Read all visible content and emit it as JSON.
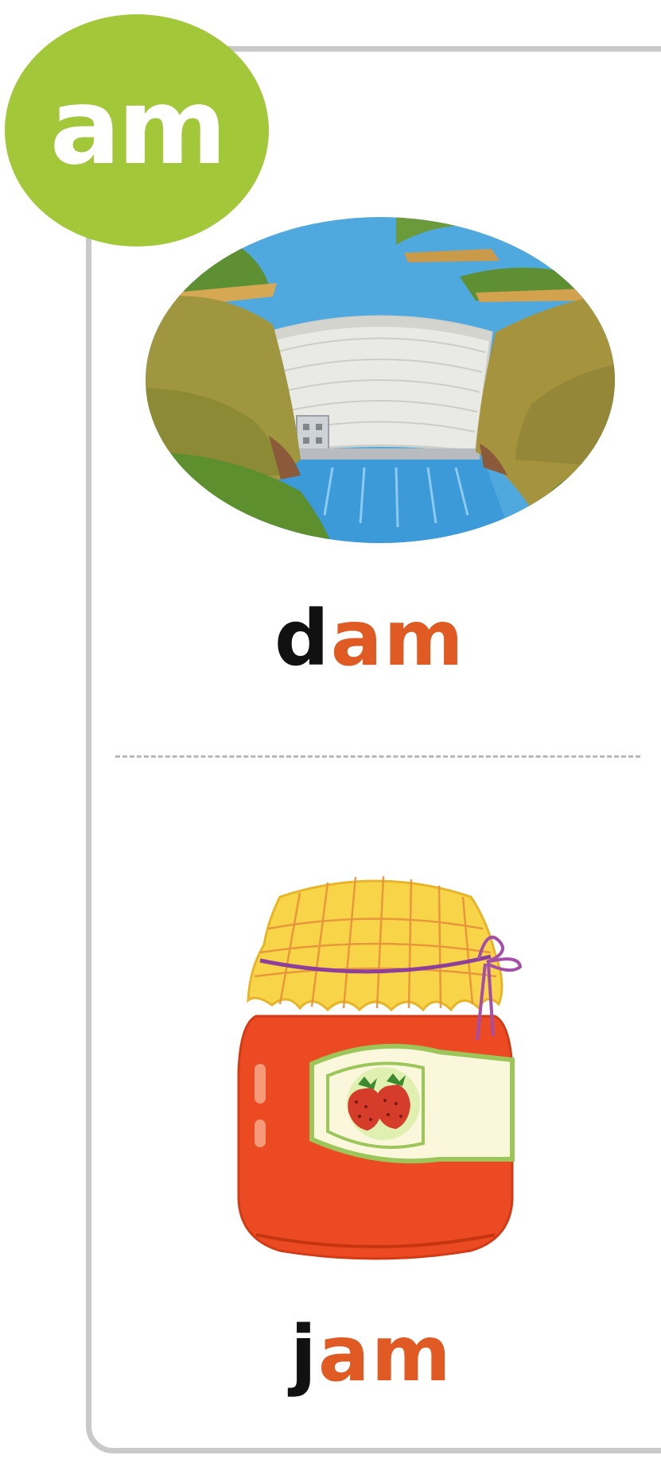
{
  "card": {
    "family_label": "am",
    "cards": [
      {
        "onset": "d",
        "rime": "am",
        "picture": "dam-illustration"
      },
      {
        "onset": "j",
        "rime": "am",
        "picture": "strawberry-jam-jar-illustration"
      }
    ]
  },
  "colors": {
    "badge": "#a2c83a",
    "rime_text": "#e05a23",
    "onset_text": "#111111",
    "card_border": "#c9c9c9"
  }
}
